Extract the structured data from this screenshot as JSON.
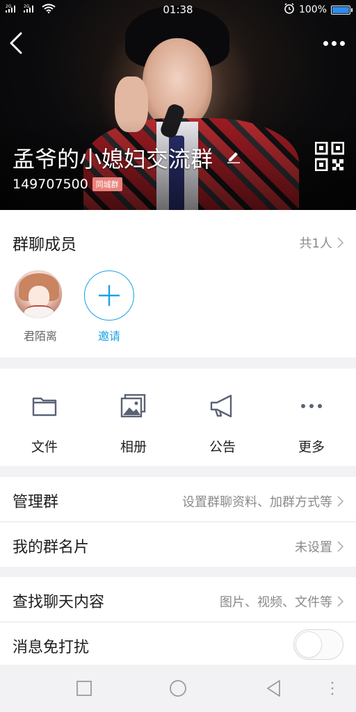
{
  "status_bar": {
    "signal_left": "2G",
    "signal_right": "2G",
    "time": "01:38",
    "battery_percent": "100%",
    "battery_level": 1.0
  },
  "header": {
    "group_name": "孟爷的小媳妇交流群",
    "group_id": "149707500",
    "badge": "同城群"
  },
  "members": {
    "title": "群聊成员",
    "count": "共1人",
    "list": [
      {
        "name": "君陌离"
      }
    ],
    "invite_label": "邀请"
  },
  "tools": [
    {
      "label": "文件",
      "icon": "folder-icon"
    },
    {
      "label": "相册",
      "icon": "album-icon"
    },
    {
      "label": "公告",
      "icon": "megaphone-icon"
    },
    {
      "label": "更多",
      "icon": "more-icon"
    }
  ],
  "rows": {
    "manage": {
      "title": "管理群",
      "value": "设置群聊资料、加群方式等"
    },
    "card": {
      "title": "我的群名片",
      "value": "未设置"
    },
    "search": {
      "title": "查找聊天内容",
      "value": "图片、视频、文件等"
    },
    "mute": {
      "title": "消息免打扰",
      "enabled": false
    }
  },
  "colors": {
    "accent": "#1aa2e6",
    "badge": "#e8837c",
    "battery": "#2e8cf0"
  }
}
